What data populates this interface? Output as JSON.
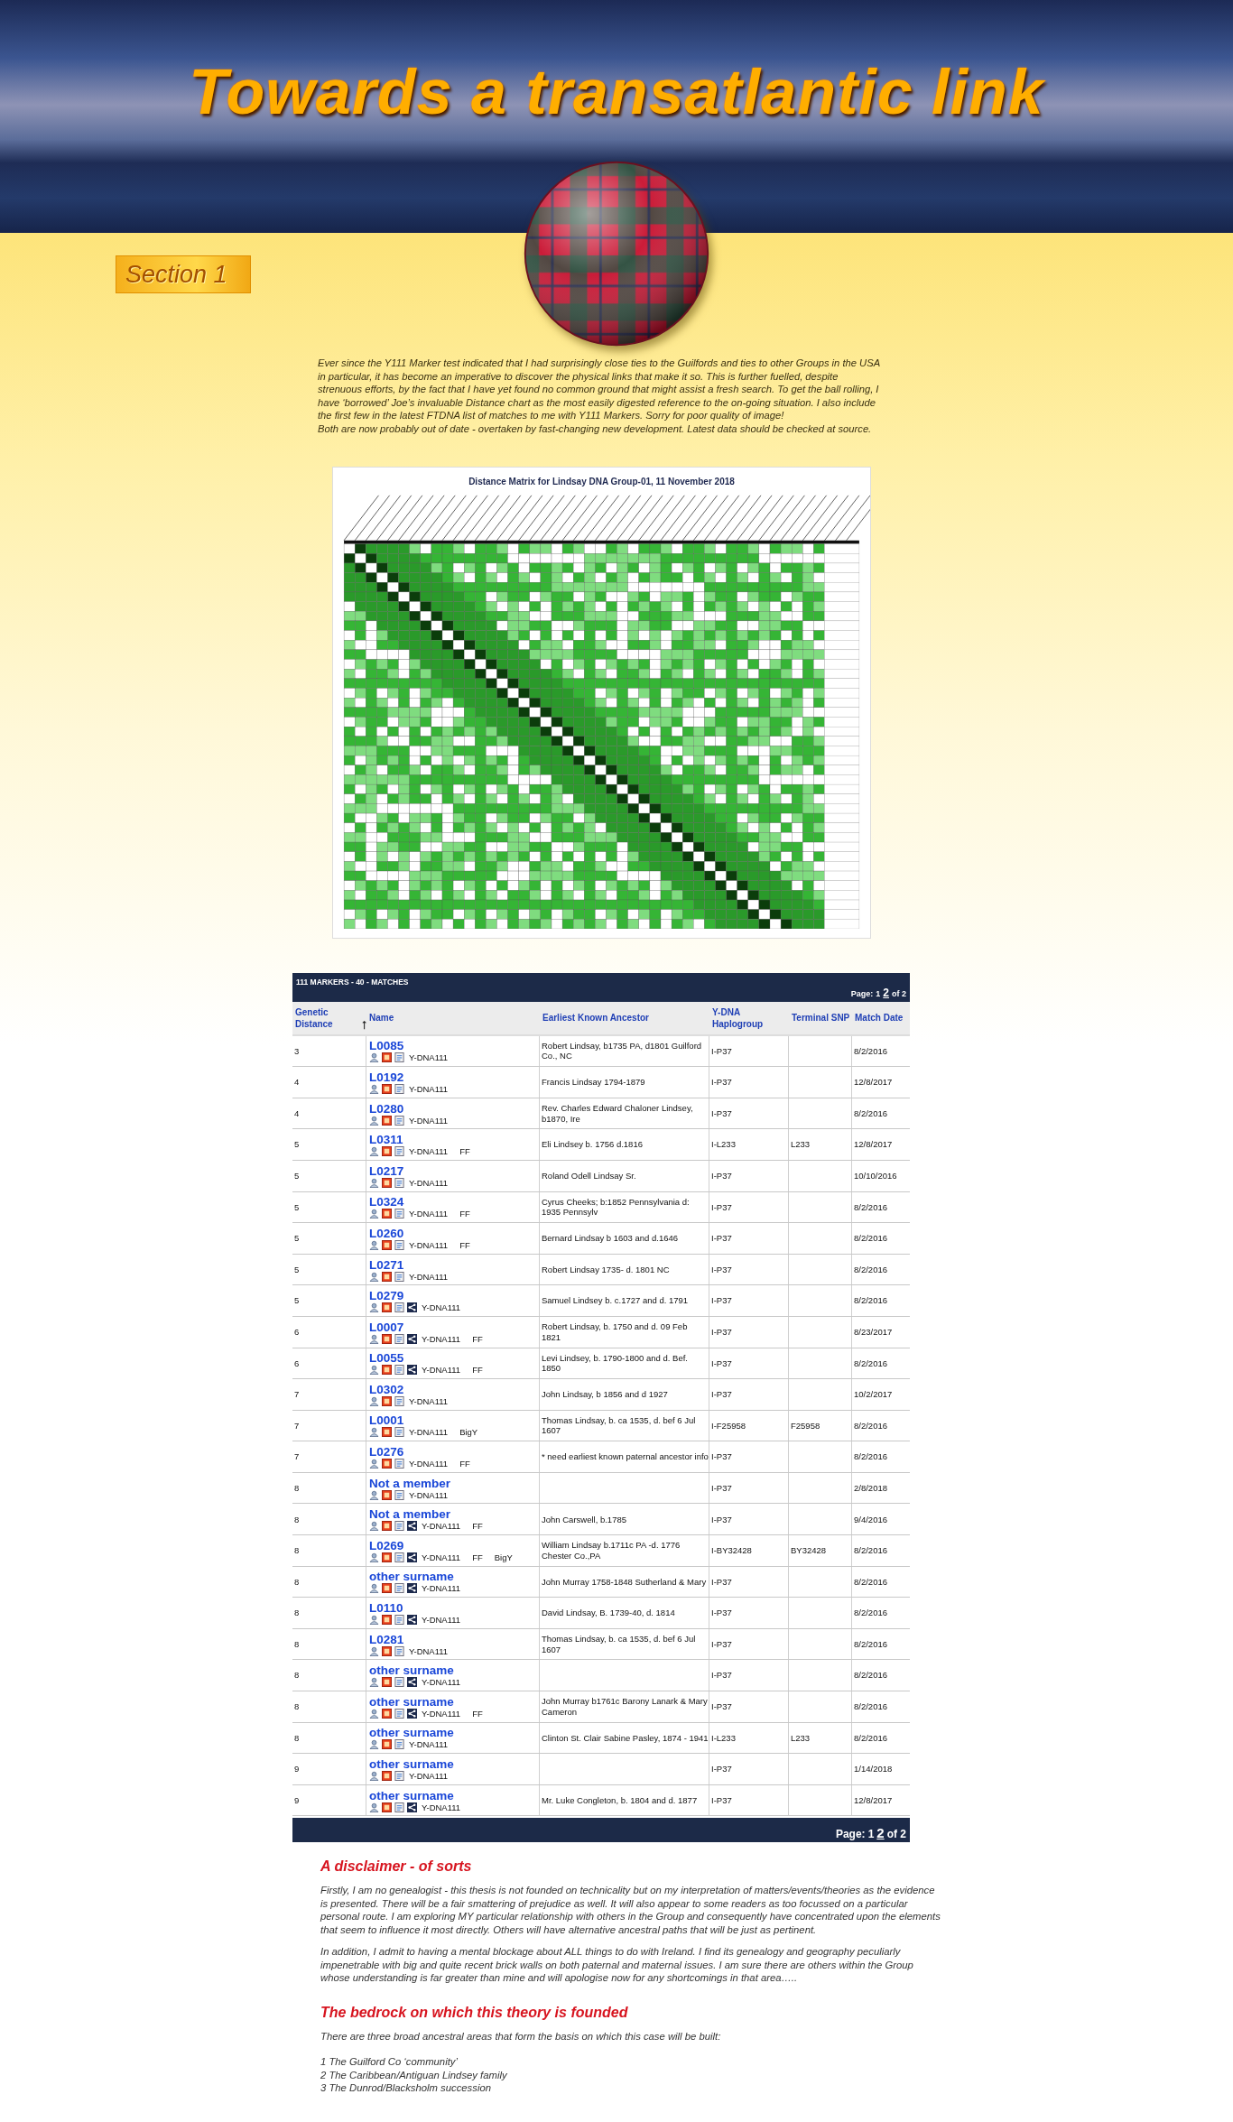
{
  "banner": {
    "title": "Towards a transatlantic link"
  },
  "section_badge": "Section 1",
  "intro": [
    "Ever since the Y111 Marker test indicated that I had surprisingly close ties to the Guilfords and ties to other Groups in the USA in particular, it has become an imperative to discover the physical links that make it so. This is further fuelled, despite strenuous efforts, by the fact that I have yet found no common ground that might assist a fresh search. To get the ball rolling, I have ‘borrowed’ Joe’s invaluable Distance chart as the most easily digested reference to the on-going situation. I also include the first few in the latest FTDNA list of matches to me with Y111 Markers. Sorry for poor quality of image!",
    "Both are now probably out of date - overtaken by fast-changing new development. Latest data should be checked at source."
  ],
  "distance_matrix": {
    "title": "Distance Matrix for Lindsay DNA Group-01, 11 November 2018"
  },
  "matches_table": {
    "heading": "111 MARKERS - 40 - MATCHES",
    "top_pager": {
      "label": "Page:",
      "pages": [
        {
          "label": "1",
          "selected": false
        },
        {
          "label": "2",
          "selected": true
        }
      ],
      "total": "of 2"
    },
    "columns": [
      "Genetic Distance",
      "Name",
      "Earliest Known Ancestor",
      "Y-DNA Haplogroup",
      "Terminal SNP",
      "Match Date"
    ],
    "rows": [
      {
        "distance": "3",
        "name": "L0085",
        "share_icon": false,
        "kit": "Y-DNA111",
        "ancestor": "Robert Lindsay, b1735 PA, d1801 Guilford Co., NC",
        "haplogroup": "I-P37",
        "date": "8/2/2016"
      },
      {
        "distance": "4",
        "name": "L0192",
        "share_icon": false,
        "kit": "Y-DNA111",
        "ancestor": "Francis Lindsay 1794-1879",
        "haplogroup": "I-P37",
        "date": "12/8/2017"
      },
      {
        "distance": "4",
        "name": "L0280",
        "share_icon": false,
        "kit": "Y-DNA111",
        "ancestor": "Rev. Charles Edward Chaloner Lindsey, b1870, Ire",
        "haplogroup": "I-P37",
        "date": "8/2/2016"
      },
      {
        "distance": "5",
        "name": "L0311",
        "share_icon": false,
        "kit": "Y-DNA111",
        "tags": [
          "FF"
        ],
        "ancestor": "Eli Lindsey b. 1756 d.1816",
        "haplogroup": "I-L233",
        "snp": "L233",
        "date": "12/8/2017"
      },
      {
        "distance": "5",
        "name": "L0217",
        "share_icon": false,
        "kit": "Y-DNA111",
        "ancestor": "Roland Odell Lindsay Sr.",
        "haplogroup": "I-P37",
        "date": "10/10/2016"
      },
      {
        "distance": "5",
        "name": "L0324",
        "share_icon": false,
        "kit": "Y-DNA111",
        "tags": [
          "FF"
        ],
        "ancestor": "Cyrus Cheeks; b:1852 Pennsylvania d: 1935 Pennsylv",
        "haplogroup": "I-P37",
        "date": "8/2/2016"
      },
      {
        "distance": "5",
        "name": "L0260",
        "share_icon": false,
        "kit": "Y-DNA111",
        "tags": [
          "FF"
        ],
        "ancestor": "Bernard Lindsay b 1603 and d.1646",
        "haplogroup": "I-P37",
        "date": "8/2/2016"
      },
      {
        "distance": "5",
        "name": "L0271",
        "share_icon": false,
        "kit": "Y-DNA111",
        "ancestor": "Robert Lindsay 1735- d. 1801 NC",
        "haplogroup": "I-P37",
        "date": "8/2/2016"
      },
      {
        "distance": "5",
        "name": "L0279",
        "share_icon": true,
        "kit": "Y-DNA111",
        "ancestor": "Samuel Lindsey b. c.1727 and d. 1791",
        "haplogroup": "I-P37",
        "date": "8/2/2016"
      },
      {
        "distance": "6",
        "name": "L0007",
        "share_icon": true,
        "kit": "Y-DNA111",
        "tags": [
          "FF"
        ],
        "ancestor": "Robert Lindsay, b. 1750 and d. 09 Feb 1821",
        "haplogroup": "I-P37",
        "date": "8/23/2017"
      },
      {
        "distance": "6",
        "name": "L0055",
        "share_icon": true,
        "kit": "Y-DNA111",
        "tags": [
          "FF"
        ],
        "ancestor": "Levi Lindsey, b. 1790-1800 and d. Bef. 1850",
        "haplogroup": "I-P37",
        "date": "8/2/2016"
      },
      {
        "distance": "7",
        "name": "L0302",
        "share_icon": false,
        "kit": "Y-DNA111",
        "ancestor": "John Lindsay, b 1856 and d 1927",
        "haplogroup": "I-P37",
        "date": "10/2/2017"
      },
      {
        "distance": "7",
        "name": "L0001",
        "share_icon": false,
        "kit": "Y-DNA111",
        "tags": [
          "BigY"
        ],
        "ancestor": "Thomas Lindsay, b. ca 1535, d. bef 6 Jul 1607",
        "haplogroup": "I-F25958",
        "snp": "F25958",
        "date": "8/2/2016"
      },
      {
        "distance": "7",
        "name": "L0276",
        "share_icon": false,
        "kit": "Y-DNA111",
        "tags": [
          "FF"
        ],
        "ancestor": "* need earliest known paternal ancestor info",
        "haplogroup": "I-P37",
        "date": "8/2/2016"
      },
      {
        "distance": "8",
        "name": "Not a member",
        "share_icon": false,
        "kit": "Y-DNA111",
        "haplogroup": "I-P37",
        "date": "2/8/2018"
      },
      {
        "distance": "8",
        "name": "Not a member",
        "share_icon": true,
        "kit": "Y-DNA111",
        "tags": [
          "FF"
        ],
        "ancestor": "John Carswell, b.1785",
        "haplogroup": "I-P37",
        "date": "9/4/2016"
      },
      {
        "distance": "8",
        "name": "L0269",
        "share_icon": true,
        "kit": "Y-DNA111",
        "tags": [
          "FF",
          "BigY"
        ],
        "ancestor": "William Lindsay b.1711c PA -d. 1776 Chester Co.,PA",
        "haplogroup": "I-BY32428",
        "snp": "BY32428",
        "date": "8/2/2016"
      },
      {
        "distance": "8",
        "name": "other surname",
        "share_icon": true,
        "kit": "Y-DNA111",
        "ancestor": "John Murray 1758-1848 Sutherland & Mary",
        "haplogroup": "I-P37",
        "date": "8/2/2016"
      },
      {
        "distance": "8",
        "name": "L0110",
        "share_icon": true,
        "kit": "Y-DNA111",
        "ancestor": "David Lindsay, B. 1739-40, d. 1814",
        "haplogroup": "I-P37",
        "date": "8/2/2016"
      },
      {
        "distance": "8",
        "name": "L0281",
        "share_icon": false,
        "kit": "Y-DNA111",
        "ancestor": "Thomas Lindsay, b. ca 1535, d. bef 6 Jul 1607",
        "haplogroup": "I-P37",
        "date": "8/2/2016"
      },
      {
        "distance": "8",
        "name": "other surname",
        "share_icon": true,
        "kit": "Y-DNA111",
        "haplogroup": "I-P37",
        "date": "8/2/2016"
      },
      {
        "distance": "8",
        "name": "other surname",
        "share_icon": true,
        "kit": "Y-DNA111",
        "tags": [
          "FF"
        ],
        "ancestor": "John Murray b1761c Barony Lanark & Mary Cameron",
        "haplogroup": "I-P37",
        "date": "8/2/2016"
      },
      {
        "distance": "8",
        "name": "other surname",
        "share_icon": false,
        "kit": "Y-DNA111",
        "ancestor": "Clinton St. Clair Sabine Pasley, 1874 - 1941",
        "haplogroup": "I-L233",
        "snp": "L233",
        "date": "8/2/2016"
      },
      {
        "distance": "9",
        "name": "other surname",
        "share_icon": false,
        "kit": "Y-DNA111",
        "haplogroup": "I-P37",
        "date": "1/14/2018"
      },
      {
        "distance": "9",
        "name": "other surname",
        "share_icon": true,
        "kit": "Y-DNA111",
        "ancestor": "Mr. Luke Congleton, b. 1804 and d. 1877",
        "haplogroup": "I-P37",
        "date": "12/8/2017"
      }
    ],
    "bottom_pager": {
      "label": "Page:",
      "pages": [
        {
          "label": "1",
          "selected": false
        },
        {
          "label": "2",
          "selected": true
        }
      ],
      "total": "of 2"
    }
  },
  "disclaimer": {
    "heading": "A disclaimer - of sorts",
    "paragraphs": [
      "Firstly, I am no genealogist - this thesis is not founded on technicality but on my interpretation of matters/events/theories as the evidence is presented. There will be a fair smattering of prejudice as well. It will also appear to some readers as too focussed on a particular personal route. I am exploring MY particular relationship with others in the Group and consequently have concentrated upon the elements that seem to influence it most directly. Others will have alternative ancestral paths that will be just as pertinent.",
      "In addition, I admit to having a mental blockage about ALL things to do with Ireland. I find its genealogy and geography peculiarly impenetrable with big and quite recent brick walls on both paternal and maternal issues. I am sure there are others within the Group whose understanding is far greater than mine and will apologise now for any shortcomings in that area….."
    ]
  },
  "bedrock": {
    "heading": "The bedrock on which this theory is founded",
    "intro": "There are three broad ancestral areas that form the basis on which this case will be built:",
    "items": [
      "1 The Guilford Co ‘community’",
      "2 The Caribbean/Antiguan Lindsey family",
      "3 The Dunrod/Blacksholm succession"
    ]
  }
}
